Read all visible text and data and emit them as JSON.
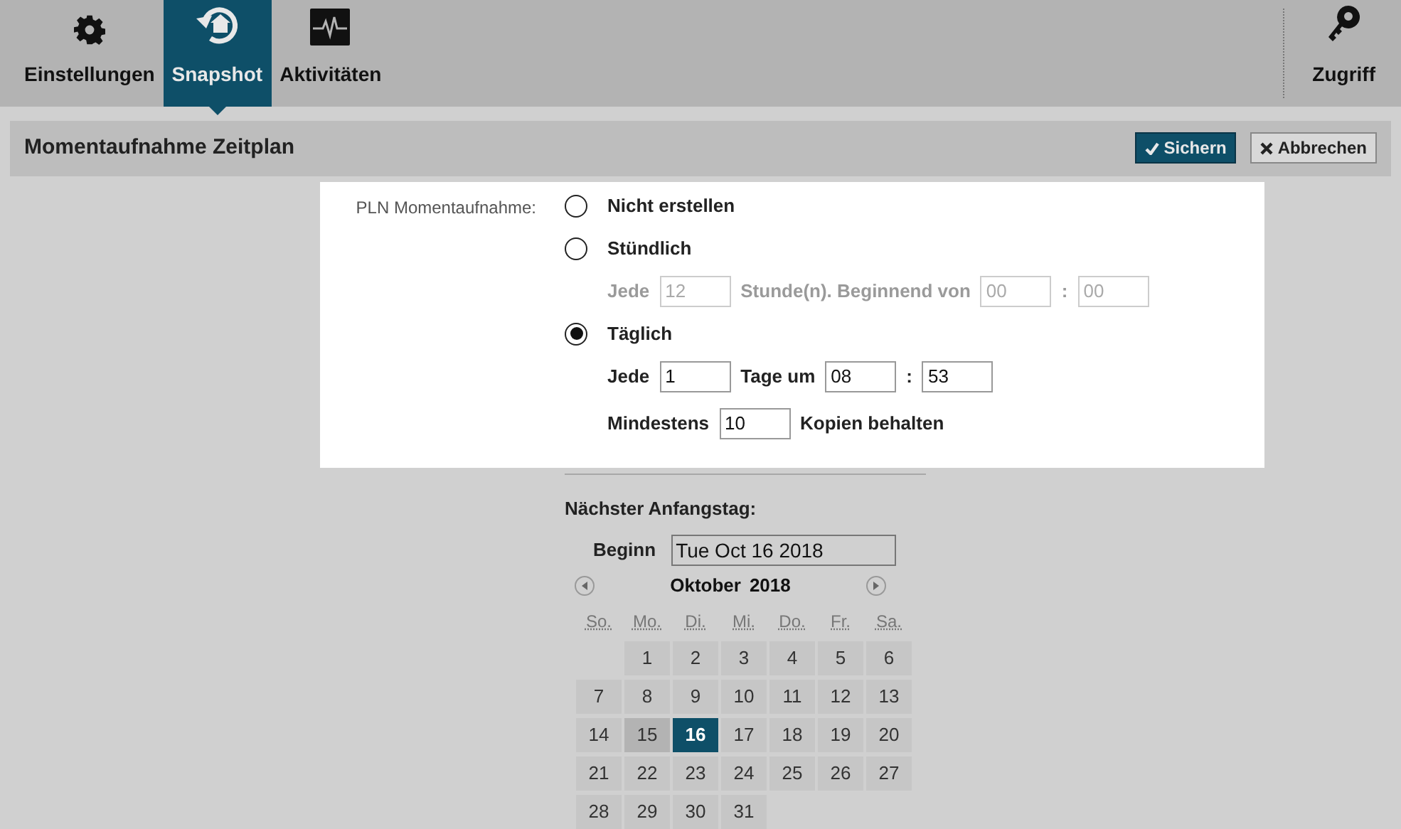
{
  "nav": {
    "tabs": [
      {
        "label": "Einstellungen",
        "selected": false
      },
      {
        "label": "Snapshot",
        "selected": true
      },
      {
        "label": "Aktivitäten",
        "selected": false
      }
    ],
    "right": [
      {
        "label": "Zugriff"
      }
    ]
  },
  "header": {
    "title": "Momentaufnahme Zeitplan",
    "buttons": [
      {
        "label": "Sichern",
        "kind": "primary"
      },
      {
        "label": "Abbrechen",
        "kind": "secondary"
      }
    ]
  },
  "form": {
    "label": "PLN Momentaufnahme:",
    "options": [
      {
        "label": "Nicht erstellen",
        "selected": false
      },
      {
        "label": "Stündlich",
        "selected": false,
        "lines": [
          {
            "disabled": true,
            "parts": [
              {
                "kind": "text",
                "text": "Jede"
              },
              {
                "kind": "field",
                "value": "12"
              },
              {
                "kind": "text",
                "text": "Stunde(n). Beginnend von"
              },
              {
                "kind": "field",
                "value": "00"
              },
              {
                "kind": "text",
                "text": ":"
              },
              {
                "kind": "field",
                "value": "00"
              }
            ]
          }
        ]
      },
      {
        "label": "Täglich",
        "selected": true,
        "lines": [
          {
            "disabled": false,
            "parts": [
              {
                "kind": "text",
                "text": "Jede"
              },
              {
                "kind": "field",
                "value": "1"
              },
              {
                "kind": "text",
                "text": "Tage um"
              },
              {
                "kind": "field",
                "value": "08"
              },
              {
                "kind": "text",
                "text": ":"
              },
              {
                "kind": "field",
                "value": "53"
              }
            ]
          }
        ]
      }
    ],
    "keep": {
      "parts": [
        {
          "kind": "text",
          "text": "Mindestens"
        },
        {
          "kind": "field",
          "value": "10"
        },
        {
          "kind": "text",
          "text": "Kopien behalten"
        }
      ]
    }
  },
  "calendar": {
    "heading": "Nächster Anfangstag:",
    "begin_label": "Beginn",
    "begin_value": "Tue Oct 16 2018",
    "month": "Oktober",
    "year": "2018",
    "weekdays": [
      "So.",
      "Mo.",
      "Di.",
      "Mi.",
      "Do.",
      "Fr.",
      "Sa."
    ],
    "weeks": [
      [
        {
          "label": "1",
          "selected": false,
          "today": false
        },
        {
          "label": "2",
          "selected": false,
          "today": false
        },
        {
          "label": "3",
          "selected": false,
          "today": false
        },
        {
          "label": "4",
          "selected": false,
          "today": false
        },
        {
          "label": "5",
          "selected": false,
          "today": false
        },
        {
          "label": "6",
          "selected": false,
          "today": false
        }
      ],
      [
        {
          "label": "7",
          "selected": false,
          "today": false
        },
        {
          "label": "8",
          "selected": false,
          "today": false
        },
        {
          "label": "9",
          "selected": false,
          "today": false
        },
        {
          "label": "10",
          "selected": false,
          "today": false
        },
        {
          "label": "11",
          "selected": false,
          "today": false
        },
        {
          "label": "12",
          "selected": false,
          "today": false
        },
        {
          "label": "13",
          "selected": false,
          "today": false
        }
      ],
      [
        {
          "label": "14",
          "selected": false,
          "today": false
        },
        {
          "label": "15",
          "selected": false,
          "today": true
        },
        {
          "label": "16",
          "selected": true,
          "today": false
        },
        {
          "label": "17",
          "selected": false,
          "today": false
        },
        {
          "label": "18",
          "selected": false,
          "today": false
        },
        {
          "label": "19",
          "selected": false,
          "today": false
        },
        {
          "label": "20",
          "selected": false,
          "today": false
        }
      ],
      [
        {
          "label": "21",
          "selected": false,
          "today": false
        },
        {
          "label": "22",
          "selected": false,
          "today": false
        },
        {
          "label": "23",
          "selected": false,
          "today": false
        },
        {
          "label": "24",
          "selected": false,
          "today": false
        },
        {
          "label": "25",
          "selected": false,
          "today": false
        },
        {
          "label": "26",
          "selected": false,
          "today": false
        },
        {
          "label": "27",
          "selected": false,
          "today": false
        }
      ],
      [
        {
          "label": "28",
          "selected": false,
          "today": false
        },
        {
          "label": "29",
          "selected": false,
          "today": false
        },
        {
          "label": "30",
          "selected": false,
          "today": false
        },
        {
          "label": "31",
          "selected": false,
          "today": false
        }
      ]
    ]
  }
}
